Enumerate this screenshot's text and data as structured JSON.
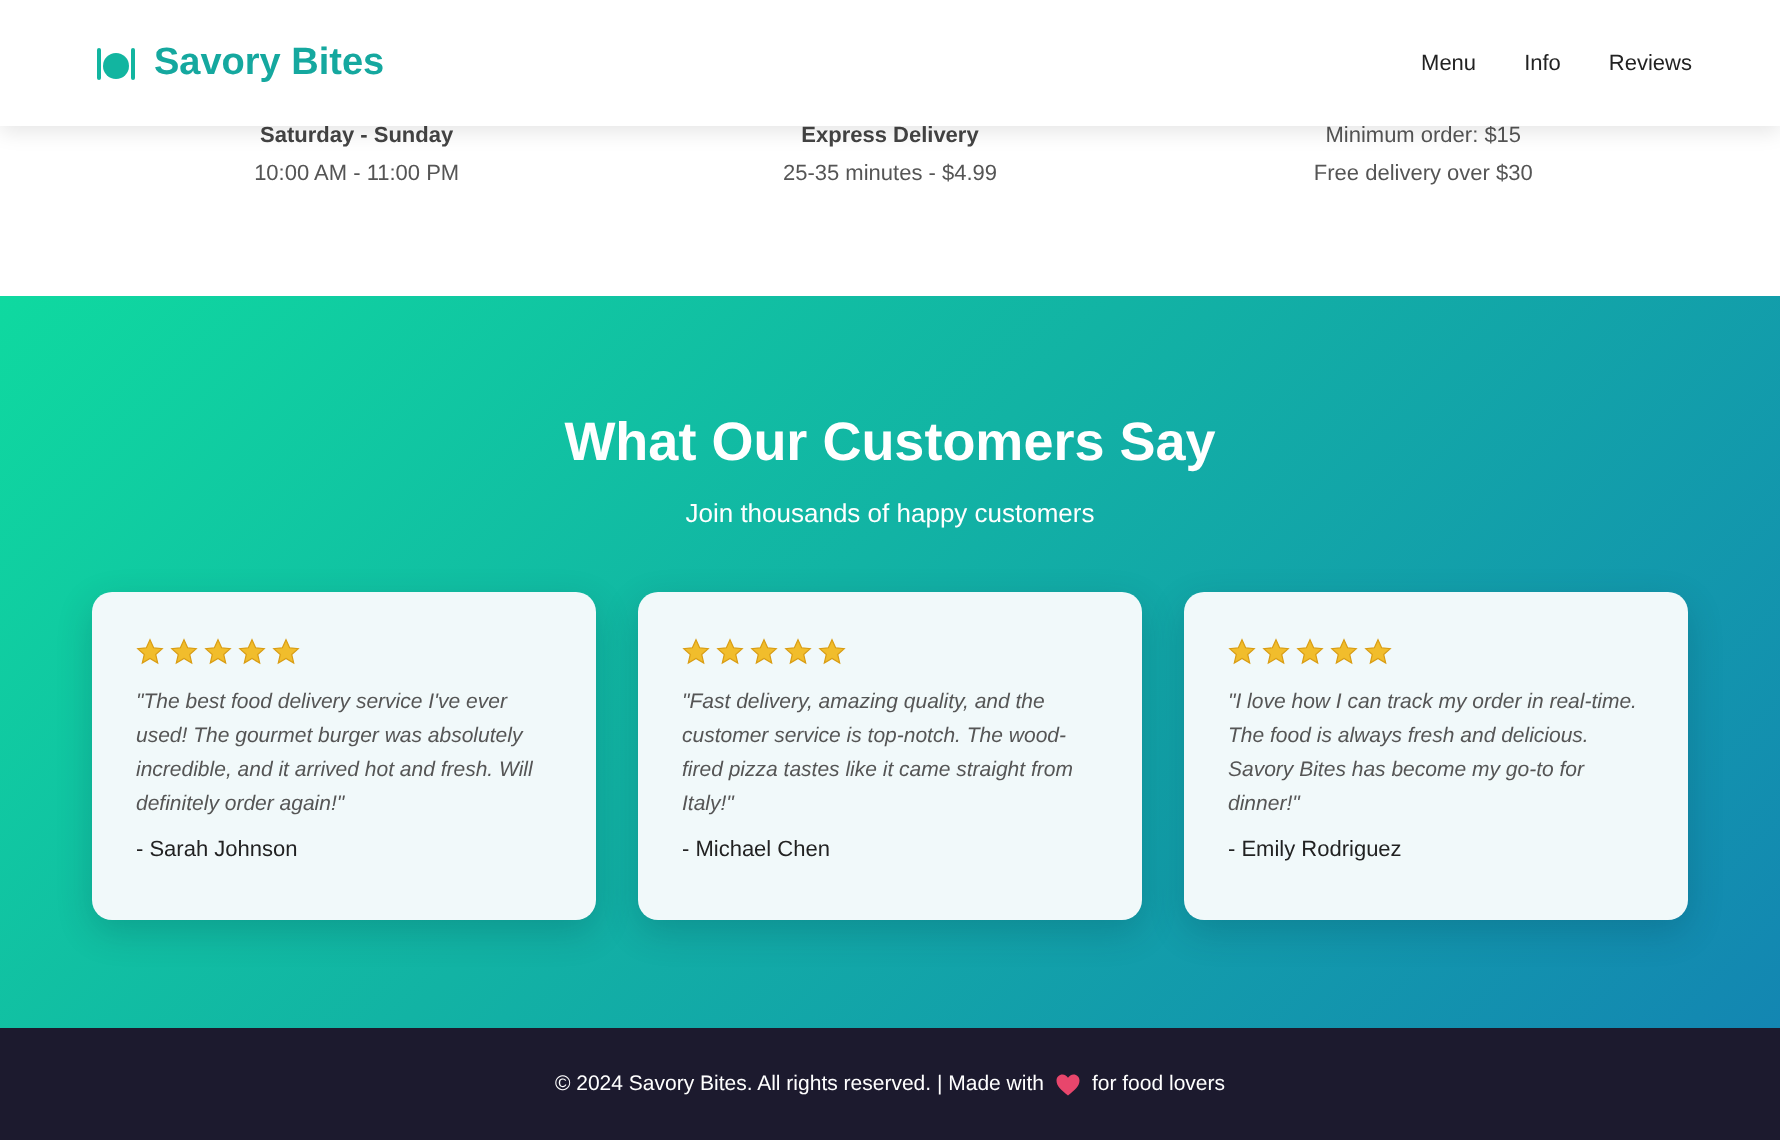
{
  "header": {
    "logo": "Savory Bites",
    "nav": [
      "Menu",
      "Info",
      "Reviews"
    ]
  },
  "info": [
    {
      "lines": [
        {
          "text": "Saturday - Sunday",
          "bold": true
        },
        {
          "text": "10:00 AM - 11:00 PM",
          "bold": false
        }
      ]
    },
    {
      "lines": [
        {
          "text": "Express Delivery",
          "bold": true
        },
        {
          "text": "25-35 minutes - $4.99",
          "bold": false
        }
      ]
    },
    {
      "lines": [
        {
          "text": "Minimum order: $15",
          "bold": false
        },
        {
          "text": "Free delivery over $30",
          "bold": false
        }
      ]
    }
  ],
  "testimonials": {
    "title": "What Our Customers Say",
    "subtitle": "Join thousands of happy customers",
    "reviews": [
      {
        "stars": 5,
        "quote": "\"The best food delivery service I've ever used! The gourmet burger was absolutely incredible, and it arrived hot and fresh. Will definitely order again!\"",
        "author": "- Sarah Johnson"
      },
      {
        "stars": 5,
        "quote": "\"Fast delivery, amazing quality, and the customer service is top-notch. The wood-fired pizza tastes like it came straight from Italy!\"",
        "author": "- Michael Chen"
      },
      {
        "stars": 5,
        "quote": "\"I love how I can track my order in real-time. The food is always fresh and delicious. Savory Bites has become my go-to for dinner!\"",
        "author": "- Emily Rodriguez"
      }
    ]
  },
  "footer": {
    "text": "© 2024 Savory Bites. All rights reserved. | Made with",
    "text_after": "for food lovers"
  }
}
